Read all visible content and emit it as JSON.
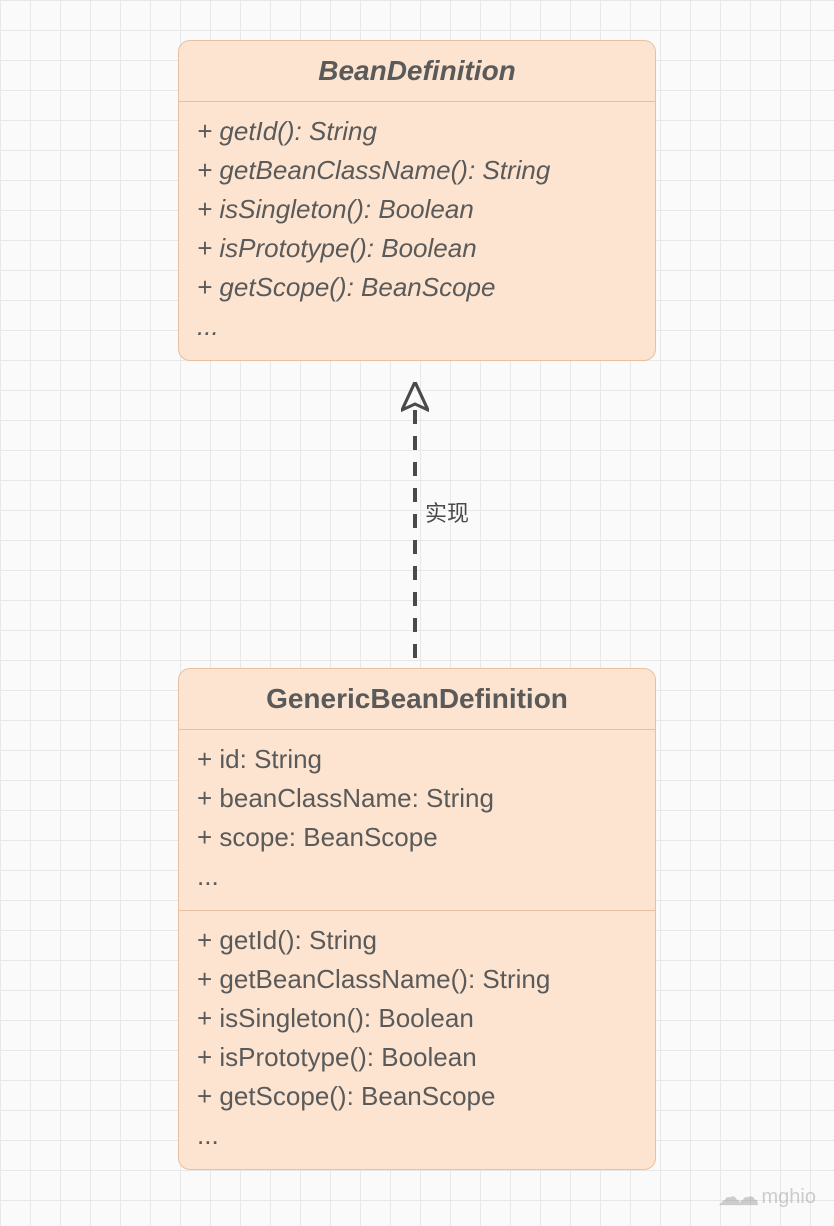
{
  "interface": {
    "name": "BeanDefinition",
    "methods": [
      "+ getId(): String",
      "+ getBeanClassName(): String",
      "+ isSingleton(): Boolean",
      "+ isPrototype(): Boolean",
      "+ getScope(): BeanScope",
      "..."
    ]
  },
  "relation": {
    "label": "实现"
  },
  "class": {
    "name": "GenericBeanDefinition",
    "attributes": [
      "+ id: String",
      "+ beanClassName: String",
      "+ scope: BeanScope",
      "..."
    ],
    "methods": [
      "+ getId(): String",
      "+ getBeanClassName(): String",
      "+ isSingleton(): Boolean",
      "+ isPrototype(): Boolean",
      "+ getScope(): BeanScope",
      "..."
    ]
  },
  "watermark": {
    "text": "mghio"
  }
}
